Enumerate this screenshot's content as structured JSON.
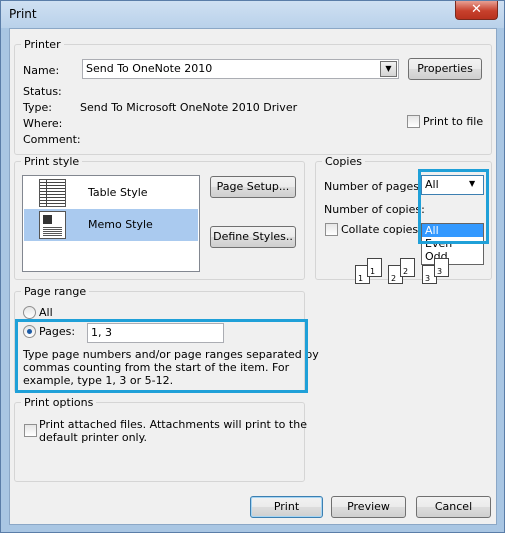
{
  "window": {
    "title": "Print",
    "close_glyph": "✕"
  },
  "printer": {
    "group_label": "Printer",
    "name_label": "Name:",
    "name_value": "Send To OneNote 2010",
    "properties_label": "Properties",
    "status_label": "Status:",
    "type_label": "Type:",
    "type_value": "Send To Microsoft OneNote 2010 Driver",
    "where_label": "Where:",
    "comment_label": "Comment:",
    "print_to_file_label": "Print to file"
  },
  "print_style": {
    "group_label": "Print style",
    "items": [
      {
        "label": "Table Style",
        "icon": "table-style-icon",
        "selected": false
      },
      {
        "label": "Memo Style",
        "icon": "memo-style-icon",
        "selected": true
      }
    ],
    "page_setup_label": "Page Setup...",
    "define_styles_label": "Define Styles.."
  },
  "copies": {
    "group_label": "Copies",
    "num_pages_label": "Number of pages:",
    "num_pages_value": "All",
    "num_pages_options": [
      "All",
      "Even",
      "Odd"
    ],
    "num_copies_label": "Number of copies:",
    "collate_label": "Collate copies",
    "collate_icon_numbers": [
      "1",
      "1",
      "2",
      "2",
      "3",
      "3"
    ]
  },
  "page_range": {
    "group_label": "Page range",
    "all_label": "All",
    "pages_label": "Pages:",
    "pages_value": "1, 3",
    "help_text_1": "Type page numbers and/or page ranges separated by",
    "help_text_2": "commas counting from the start of the item.  For",
    "help_text_3": "example, type 1, 3 or 5-12."
  },
  "print_options": {
    "group_label": "Print options",
    "attached_line_1": "Print attached files.  Attachments will print to the",
    "attached_line_2": "default printer only."
  },
  "footer": {
    "print_label": "Print",
    "preview_label": "Preview",
    "cancel_label": "Cancel"
  },
  "colors": {
    "highlight": "#1fa0d8",
    "selection": "#aacaef",
    "dropdown_selection": "#3399ff"
  }
}
